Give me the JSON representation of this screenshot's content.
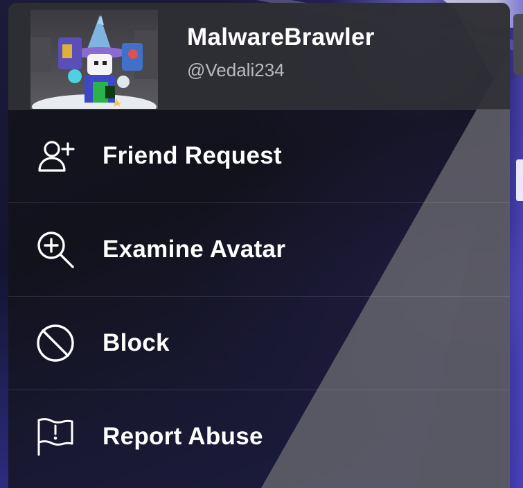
{
  "profile": {
    "display_name": "MalwareBrawler",
    "username": "@Vedali234"
  },
  "menu": {
    "items": [
      {
        "label": "Friend Request",
        "icon": "add-friend-icon"
      },
      {
        "label": "Examine Avatar",
        "icon": "zoom-in-icon"
      },
      {
        "label": "Block",
        "icon": "block-icon"
      },
      {
        "label": "Report Abuse",
        "icon": "report-flag-icon"
      }
    ]
  },
  "colors": {
    "menu_background": "#121216",
    "header_background": "#303036",
    "text_primary": "#ffffff",
    "text_secondary": "#b9b9be"
  }
}
